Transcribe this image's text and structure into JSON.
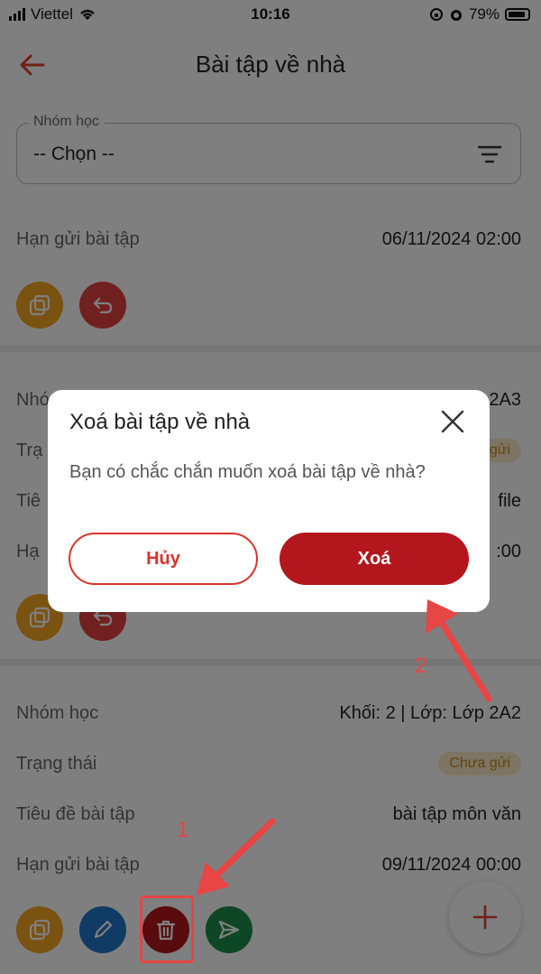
{
  "status_bar": {
    "carrier": "Viettel",
    "time": "10:16",
    "battery": "79%"
  },
  "header": {
    "title": "Bài tập về nhà"
  },
  "filter": {
    "label": "Nhóm học",
    "value": "-- Chọn --"
  },
  "card1": {
    "deadline_label": "Hạn gửi bài tập",
    "deadline_value": "06/11/2024 02:00"
  },
  "card2": {
    "partial": {
      "row1_key": "Nhó",
      "row1_val": "2A3",
      "row2_key": "Trạ",
      "row2_val": "gửi",
      "row3_key": "Tiê",
      "row3_val": "file",
      "row4_key": "Hạ",
      "row4_val": ":00"
    }
  },
  "card3": {
    "group_label": "Nhóm học",
    "group_value": "Khối: 2 | Lớp: Lớp 2A2",
    "status_label": "Trạng thái",
    "status_value": "Chưa gửi",
    "title_label": "Tiêu đề bài tập",
    "title_value": "bài tập môn văn",
    "deadline_label": "Hạn gửi bài tập",
    "deadline_value": "09/11/2024 00:00"
  },
  "dialog": {
    "title": "Xoá bài tập về nhà",
    "message": "Bạn có chắc chắn muốn xoá bài tập về nhà?",
    "cancel_label": "Hủy",
    "confirm_label": "Xoá"
  },
  "annotations": {
    "step1": "1",
    "step2": "2"
  },
  "colors": {
    "accent": "#b3161c",
    "orange": "#f5a623",
    "annotation": "#e84545"
  },
  "icons": [
    "back-arrow-icon",
    "filter-icon",
    "copy-icon",
    "undo-icon",
    "edit-icon",
    "trash-icon",
    "send-icon",
    "plus-icon",
    "close-icon"
  ]
}
